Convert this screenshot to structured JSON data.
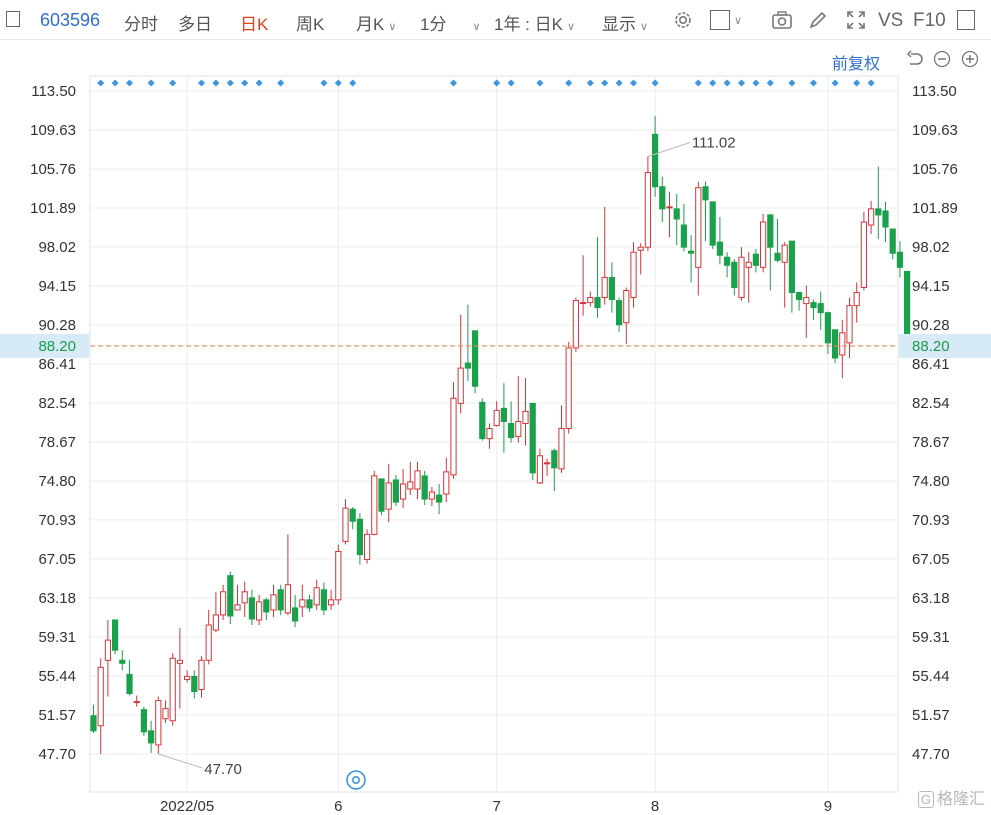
{
  "toolbar": {
    "code": "603596",
    "tab_fenshi": "分时",
    "tab_duori": "多日",
    "tab_rik": "日K",
    "tab_zhouk": "周K",
    "tab_yuek": "月K",
    "tab_1fen": "1分",
    "range": "1年 : 日K",
    "display": "显示",
    "vs": "VS",
    "f10": "F10"
  },
  "adjust_label": "前复权",
  "watermark": "格隆汇",
  "chart_data": {
    "type": "candlestick",
    "y_ticks": [
      113.5,
      109.63,
      105.76,
      101.89,
      98.02,
      94.15,
      90.28,
      86.41,
      82.54,
      78.67,
      74.8,
      70.93,
      67.05,
      63.18,
      59.31,
      55.44,
      51.57,
      47.7
    ],
    "y_tick_labels": [
      "113.50",
      "109.63",
      "105.76",
      "101.89",
      "98.02",
      "94.15",
      "90.28",
      "86.41",
      "82.54",
      "78.67",
      "74.80",
      "70.93",
      "67.05",
      "63.18",
      "59.31",
      "55.44",
      "51.57",
      "47.70"
    ],
    "ylim": [
      45.9,
      115.3
    ],
    "x_labels": [
      "2022/05",
      "6",
      "7",
      "8",
      "9"
    ],
    "x_label_bar_index": [
      13,
      34,
      56,
      78,
      102
    ],
    "current_price": 88.2,
    "current_price_label": "88.20",
    "max_label": "111.02",
    "max_bar_index": 77,
    "min_label": "47.70",
    "min_bar_index": 9,
    "bars": [
      [
        51.5,
        50.0,
        52.6,
        49.8
      ],
      [
        50.5,
        56.3,
        57.2,
        47.7
      ],
      [
        57.0,
        59.0,
        61.0,
        53.4
      ],
      [
        61.0,
        58.0,
        61.0,
        57.6
      ],
      [
        57.0,
        56.7,
        58.0,
        56.0
      ],
      [
        55.6,
        53.7,
        57.0,
        53.5
      ],
      [
        52.8,
        52.9,
        53.5,
        52.4
      ],
      [
        52.1,
        49.9,
        52.4,
        49.5
      ],
      [
        50.0,
        48.8,
        51.0,
        47.8
      ],
      [
        48.6,
        53.0,
        53.4,
        47.7
      ],
      [
        51.2,
        52.2,
        53.0,
        50.8
      ],
      [
        51.0,
        57.2,
        57.7,
        50.5
      ],
      [
        56.7,
        57.0,
        60.2,
        52.2
      ],
      [
        55.1,
        55.4,
        56.0,
        54.8
      ],
      [
        55.4,
        53.9,
        56.0,
        53.2
      ],
      [
        54.1,
        57.0,
        57.4,
        53.3
      ],
      [
        57.0,
        60.5,
        62.0,
        56.6
      ],
      [
        60.0,
        61.5,
        63.8,
        59.8
      ],
      [
        61.5,
        63.8,
        64.5,
        61.0
      ],
      [
        65.4,
        61.4,
        65.8,
        60.6
      ],
      [
        62.0,
        62.5,
        64.5,
        62.0
      ],
      [
        62.7,
        63.8,
        64.8,
        61.3
      ],
      [
        63.2,
        61.1,
        64.0,
        60.5
      ],
      [
        61.0,
        62.8,
        63.5,
        60.5
      ],
      [
        63.0,
        61.8,
        63.2,
        61.0
      ],
      [
        62.0,
        63.5,
        64.5,
        61.3
      ],
      [
        64.0,
        62.0,
        64.5,
        61.5
      ],
      [
        61.7,
        64.5,
        69.5,
        61.5
      ],
      [
        62.2,
        60.9,
        63.5,
        60.3
      ],
      [
        62.3,
        63.0,
        64.5,
        61.3
      ],
      [
        63.0,
        62.2,
        63.5,
        61.8
      ],
      [
        62.5,
        64.2,
        65.0,
        62.0
      ],
      [
        64.0,
        62.0,
        64.7,
        61.5
      ],
      [
        62.5,
        63.0,
        64.0,
        62.0
      ],
      [
        63.0,
        67.8,
        68.5,
        62.5
      ],
      [
        68.8,
        72.1,
        73.0,
        68.5
      ],
      [
        72.0,
        70.8,
        72.2,
        70.0
      ],
      [
        71.0,
        67.5,
        71.6,
        66.5
      ],
      [
        67.0,
        69.5,
        70.0,
        66.6
      ],
      [
        69.5,
        75.3,
        75.8,
        69.4
      ],
      [
        75.0,
        71.8,
        75.0,
        71.4
      ],
      [
        72.0,
        74.6,
        76.5,
        70.7
      ],
      [
        74.9,
        72.7,
        75.4,
        72.3
      ],
      [
        73.0,
        74.5,
        76.0,
        72.1
      ],
      [
        74.0,
        74.7,
        76.7,
        73.4
      ],
      [
        74.0,
        75.8,
        76.7,
        73.0
      ],
      [
        75.3,
        73.0,
        75.8,
        72.4
      ],
      [
        73.0,
        73.7,
        74.2,
        72.3
      ],
      [
        73.4,
        72.7,
        74.5,
        71.5
      ],
      [
        73.5,
        75.7,
        77.1,
        72.7
      ],
      [
        75.4,
        83.0,
        84.6,
        75.0
      ],
      [
        82.5,
        86.0,
        91.3,
        81.5
      ],
      [
        86.5,
        86.0,
        92.3,
        84.7
      ],
      [
        89.7,
        84.2,
        89.7,
        83.5
      ],
      [
        82.6,
        79.0,
        83.0,
        78.8
      ],
      [
        79.0,
        80.0,
        80.5,
        78.0
      ],
      [
        80.3,
        81.8,
        82.7,
        80.2
      ],
      [
        82.0,
        80.7,
        84.5,
        77.6
      ],
      [
        80.5,
        79.1,
        82.7,
        78.6
      ],
      [
        79.2,
        80.7,
        85.2,
        78.6
      ],
      [
        80.5,
        81.7,
        85.0,
        78.3
      ],
      [
        82.5,
        75.6,
        82.5,
        74.9
      ],
      [
        74.6,
        77.3,
        78.0,
        74.5
      ],
      [
        76.5,
        76.6,
        77.0,
        75.3
      ],
      [
        77.8,
        76.1,
        78.0,
        73.8
      ],
      [
        76.0,
        80.0,
        82.3,
        75.6
      ],
      [
        80.0,
        88.0,
        88.6,
        79.5
      ],
      [
        88.0,
        92.7,
        93.0,
        87.6
      ],
      [
        92.5,
        92.5,
        97.2,
        91.2
      ],
      [
        92.5,
        93.0,
        93.6,
        92.1
      ],
      [
        93.0,
        92.0,
        99.0,
        91.0
      ],
      [
        93.0,
        95.0,
        102.0,
        92.3
      ],
      [
        95.0,
        92.8,
        96.5,
        91.5
      ],
      [
        92.7,
        90.3,
        93.0,
        89.6
      ],
      [
        90.5,
        93.7,
        94.0,
        88.4
      ],
      [
        93.0,
        97.5,
        98.5,
        92.0
      ],
      [
        97.7,
        98.0,
        98.4,
        95.3
      ],
      [
        98.0,
        105.4,
        107.0,
        97.6
      ],
      [
        109.2,
        104.0,
        111.02,
        103.0
      ],
      [
        104.0,
        101.8,
        105.0,
        100.5
      ],
      [
        102.0,
        102.0,
        103.5,
        99.0
      ],
      [
        101.8,
        100.8,
        103.3,
        98.2
      ],
      [
        100.2,
        98.0,
        102.3,
        97.6
      ],
      [
        97.6,
        97.4,
        99.2,
        94.5
      ],
      [
        96.0,
        103.9,
        104.5,
        93.2
      ],
      [
        104.0,
        102.7,
        104.5,
        98.6
      ],
      [
        102.5,
        98.2,
        102.5,
        97.8
      ],
      [
        98.5,
        97.2,
        101.0,
        96.3
      ],
      [
        97.0,
        96.2,
        97.5,
        95.0
      ],
      [
        96.5,
        94.0,
        96.8,
        93.2
      ],
      [
        93.0,
        97.0,
        98.0,
        92.7
      ],
      [
        96.0,
        96.5,
        97.5,
        92.5
      ],
      [
        97.3,
        96.2,
        97.8,
        95.5
      ],
      [
        96.0,
        100.5,
        101.3,
        95.5
      ],
      [
        101.2,
        98.0,
        101.3,
        93.7
      ],
      [
        97.4,
        96.7,
        100.8,
        96.5
      ],
      [
        96.5,
        98.2,
        98.5,
        92.0
      ],
      [
        98.6,
        93.5,
        98.6,
        91.5
      ],
      [
        93.5,
        92.8,
        93.6,
        91.7
      ],
      [
        92.4,
        93.0,
        94.2,
        89.0
      ],
      [
        92.5,
        92.0,
        92.8,
        90.8
      ],
      [
        92.4,
        91.5,
        93.6,
        89.8
      ],
      [
        91.5,
        88.5,
        91.6,
        87.4
      ],
      [
        89.8,
        87.0,
        89.8,
        86.5
      ],
      [
        87.3,
        89.5,
        90.8,
        85.0
      ],
      [
        88.5,
        92.2,
        93.0,
        87.0
      ],
      [
        92.2,
        93.5,
        94.5,
        90.5
      ],
      [
        94.0,
        100.5,
        101.5,
        93.7
      ],
      [
        100.2,
        101.8,
        102.6,
        99.3
      ],
      [
        101.8,
        101.2,
        106.0,
        98.8
      ],
      [
        101.6,
        100.0,
        102.5,
        98.5
      ],
      [
        99.8,
        97.4,
        99.8,
        96.8
      ],
      [
        97.5,
        96.0,
        98.6,
        95.0
      ],
      [
        95.6,
        88.2,
        95.6,
        87.6
      ]
    ],
    "markers_bar_index": [
      1,
      3,
      5,
      8,
      11,
      15,
      17,
      19,
      21,
      23,
      26,
      32,
      34,
      36,
      50,
      56,
      58,
      62,
      66,
      69,
      71,
      73,
      75,
      78,
      84,
      86,
      88,
      90,
      92,
      94,
      97,
      100,
      103,
      106,
      108
    ],
    "colors": {
      "up": "#d3363a",
      "down": "#1aa14b",
      "price_line": "#e08a5a",
      "price_tag_bg": "#d7eaf8",
      "price_tag_text": "#1a9c48",
      "marker": "#3e95e0",
      "grid": "#ececec"
    }
  }
}
